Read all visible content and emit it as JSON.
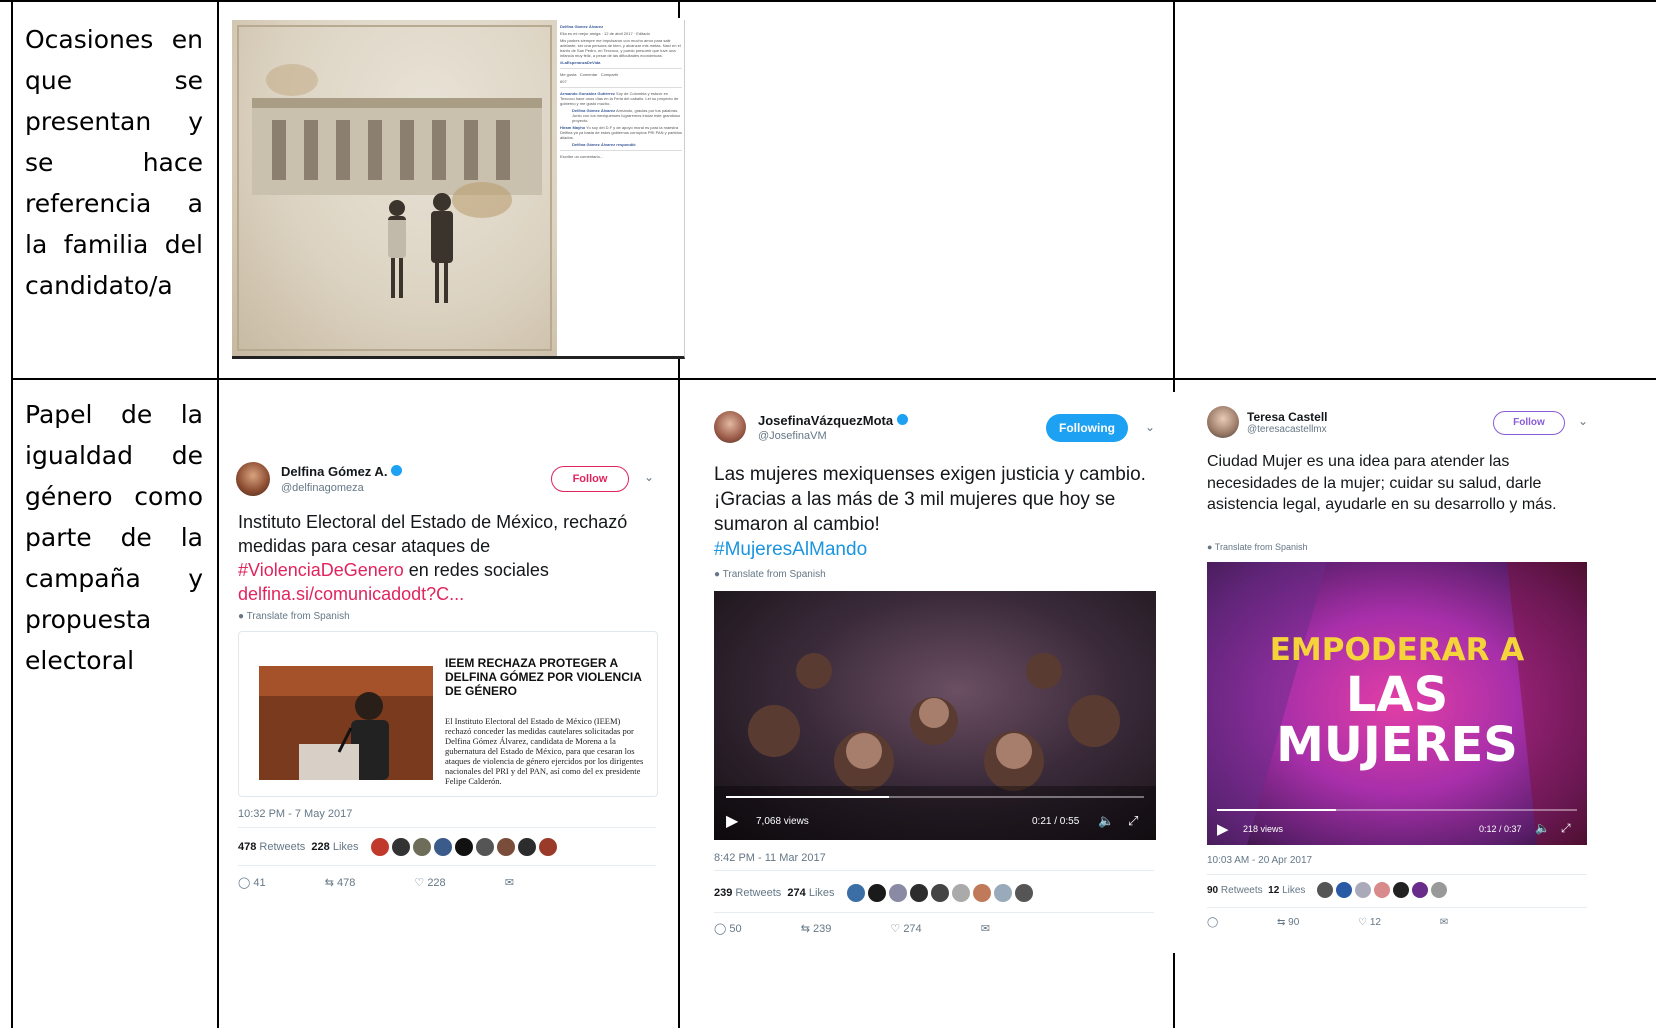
{
  "rows": [
    {
      "label": "Ocasiones en que se presentan y se hace referencia a la familia del candidato/a"
    },
    {
      "label": "Papel de la igualdad de género como parte de la campaña y propuesta electoral"
    }
  ],
  "facebook_post": {
    "author": "Delfina Gómez Álvarez",
    "meta": "Ella es mi mejor amiga · 12 de abril 2017 · Editado",
    "text": "Mis padres siempre me impulsaron con mucho amor para salir adelante, ser una persona de bien, y alcanzar mis metas. Nací en el barrio de San Pedro, en Texcoco, y puedo presumir que tuve una infancia muy feliz, a pesar de las dificultades económicas.",
    "hashtag": "#LaEsperanzaDeVida",
    "actions": [
      "Me gusta",
      "Comentar",
      "Compartir"
    ],
    "reactions_count": "607",
    "comment_1_author": "Armando González Gutiérrez",
    "comment_1_text": "Soy de Colombia y estuve en Texcoco hace unos días en la Feria del caballo. Leí su proyecto de gobierno y me gustó mucho.",
    "reply_author": "Delfina Gómez Álvarez",
    "reply_text": "Armando, gracias por tus palabras. Junto con los mexiquenses lograremos iniciar este grandioso proyecto.",
    "comment_2_author": "Hiram Mayho",
    "comment_2_text": "Yo soy del D.F y de apoyo moral es para la maestra Delfina ya ya basta de estos gobiernos corruptos PRI PAN y partidos aliados.",
    "reply_2": "Delfina Gómez Álvarez respondió",
    "write_comment": "Escribe un comentario..."
  },
  "tweets": [
    {
      "name": "Delfina Gómez A.",
      "handle": "@delfinagomeza",
      "button": "Follow",
      "text_plain": "Instituto Electoral del Estado de México, rechazó medidas para cesar ataques de ",
      "hashtag": "#ViolenciaDeGenero",
      "text_after": " en redes sociales",
      "link": "delfina.si/comunicadodt?C...",
      "translate": "Translate from Spanish",
      "card_title": "IEEM RECHAZA PROTEGER A DELFINA GÓMEZ POR VIOLENCIA DE GÉNERO",
      "card_body": "El Instituto Electoral del Estado de México (IEEM) rechazó conceder las medidas cautelares solicitadas por Delfina Gómez Álvarez, candidata de Morena a la gubernatura del Estado de México, para que cesaran los ataques de violencia de género ejercidos por los dirigentes nacionales del PRI y del PAN, así como del ex presidente Felipe Calderón.",
      "timestamp": "10:32 PM - 7 May 2017",
      "retweets": "478",
      "retweets_label": "Retweets",
      "likes": "228",
      "likes_label": "Likes",
      "reply_count": "41",
      "rt_count": "478",
      "like_count": "228"
    },
    {
      "name": "JosefinaVázquezMota",
      "handle": "@JosefinaVM",
      "button": "Following",
      "text_plain": "Las mujeres mexiquenses exigen justicia y cambio. ¡Gracias a las más de 3 mil mujeres que hoy se sumaron al cambio!",
      "hashtag": "#MujeresAlMando",
      "translate": "Translate from Spanish",
      "views": "7,068 views",
      "time": "0:21 / 0:55",
      "progress": 0.39,
      "timestamp": "8:42 PM - 11 Mar 2017",
      "retweets": "239",
      "retweets_label": "Retweets",
      "likes": "274",
      "likes_label": "Likes",
      "reply_count": "50",
      "rt_count": "239",
      "like_count": "274"
    },
    {
      "name": "Teresa Castell",
      "handle": "@teresacastellmx",
      "button": "Follow",
      "text_plain": "Ciudad Mujer es una idea para atender las necesidades de la mujer; cuidar su salud, darle asistencia legal, ayudarle en su desarrollo y más.",
      "translate": "Translate from Spanish",
      "video_line1": "EMPODERAR A",
      "video_line2": "LAS",
      "video_line3": "MUJERES",
      "views": "218 views",
      "time": "0:12 / 0:37",
      "progress": 0.33,
      "timestamp": "10:03 AM - 20 Apr 2017",
      "retweets": "90",
      "retweets_label": "Retweets",
      "likes": "12",
      "likes_label": "Likes",
      "reply_count": "",
      "rt_count": "90",
      "like_count": "12"
    }
  ],
  "colors": {
    "twitter_blue": "#1da1f2",
    "follow_pink": "#e0245e",
    "grid": "#000000"
  }
}
